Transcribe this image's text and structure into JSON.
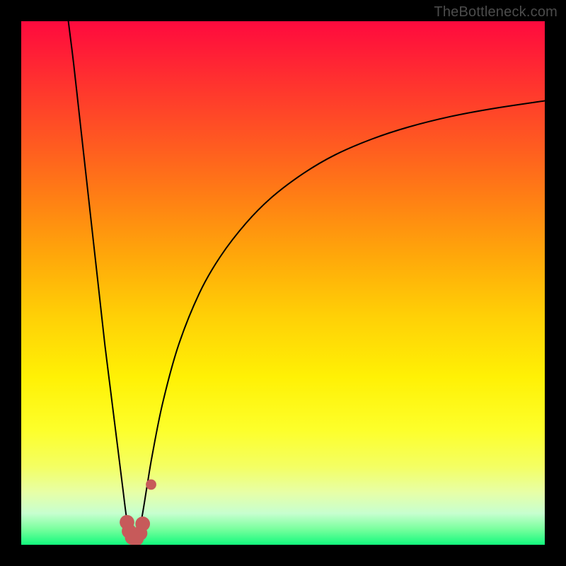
{
  "watermark": "TheBottleneck.com",
  "chart_data": {
    "type": "line",
    "title": "",
    "xlabel": "",
    "ylabel": "",
    "xlim": [
      0,
      100
    ],
    "ylim": [
      0,
      100
    ],
    "grid": false,
    "legend": false,
    "optimal_x": 21.5,
    "series": [
      {
        "name": "left-curve",
        "stroke": "#000000",
        "values": [
          {
            "x": 9.0,
            "y": 100.0
          },
          {
            "x": 10.0,
            "y": 92.0
          },
          {
            "x": 11.0,
            "y": 83.0
          },
          {
            "x": 12.0,
            "y": 74.0
          },
          {
            "x": 13.0,
            "y": 65.0
          },
          {
            "x": 14.0,
            "y": 56.0
          },
          {
            "x": 15.0,
            "y": 47.0
          },
          {
            "x": 16.0,
            "y": 38.0
          },
          {
            "x": 17.0,
            "y": 30.0
          },
          {
            "x": 18.0,
            "y": 22.0
          },
          {
            "x": 19.0,
            "y": 14.0
          },
          {
            "x": 19.5,
            "y": 10.0
          },
          {
            "x": 20.0,
            "y": 6.0
          },
          {
            "x": 20.5,
            "y": 3.0
          },
          {
            "x": 21.0,
            "y": 1.0
          },
          {
            "x": 21.5,
            "y": 0.2
          }
        ]
      },
      {
        "name": "right-curve",
        "stroke": "#000000",
        "values": [
          {
            "x": 21.5,
            "y": 0.2
          },
          {
            "x": 22.0,
            "y": 1.0
          },
          {
            "x": 23.0,
            "y": 5.0
          },
          {
            "x": 24.0,
            "y": 11.0
          },
          {
            "x": 25.0,
            "y": 17.0
          },
          {
            "x": 27.0,
            "y": 27.0
          },
          {
            "x": 30.0,
            "y": 38.0
          },
          {
            "x": 34.0,
            "y": 48.0
          },
          {
            "x": 38.0,
            "y": 55.0
          },
          {
            "x": 43.0,
            "y": 61.5
          },
          {
            "x": 48.0,
            "y": 66.5
          },
          {
            "x": 54.0,
            "y": 71.0
          },
          {
            "x": 60.0,
            "y": 74.5
          },
          {
            "x": 67.0,
            "y": 77.5
          },
          {
            "x": 74.0,
            "y": 79.8
          },
          {
            "x": 82.0,
            "y": 81.8
          },
          {
            "x": 90.0,
            "y": 83.3
          },
          {
            "x": 100.0,
            "y": 84.8
          }
        ]
      }
    ],
    "markers": [
      {
        "name": "marker-left-1",
        "x": 20.2,
        "y": 4.3,
        "r": 1.4,
        "fill": "#c75a5a"
      },
      {
        "name": "marker-left-2",
        "x": 20.6,
        "y": 2.6,
        "r": 1.4,
        "fill": "#c75a5a"
      },
      {
        "name": "marker-left-3",
        "x": 21.2,
        "y": 1.4,
        "r": 1.4,
        "fill": "#c75a5a"
      },
      {
        "name": "marker-bottom-1",
        "x": 22.0,
        "y": 1.2,
        "r": 1.4,
        "fill": "#c75a5a"
      },
      {
        "name": "marker-right-1",
        "x": 22.7,
        "y": 2.2,
        "r": 1.4,
        "fill": "#c75a5a"
      },
      {
        "name": "marker-right-2",
        "x": 23.2,
        "y": 4.0,
        "r": 1.4,
        "fill": "#c75a5a"
      },
      {
        "name": "marker-gap",
        "x": 24.8,
        "y": 11.5,
        "r": 1.0,
        "fill": "#c75a5a"
      }
    ],
    "gradient_stops": [
      {
        "pct": 0,
        "color": "#ff0a3e"
      },
      {
        "pct": 6,
        "color": "#ff1e36"
      },
      {
        "pct": 14,
        "color": "#ff3a2c"
      },
      {
        "pct": 24,
        "color": "#ff5c20"
      },
      {
        "pct": 34,
        "color": "#ff8014"
      },
      {
        "pct": 45,
        "color": "#ffa80a"
      },
      {
        "pct": 56,
        "color": "#ffcf06"
      },
      {
        "pct": 68,
        "color": "#fff105"
      },
      {
        "pct": 78,
        "color": "#fdff2a"
      },
      {
        "pct": 85,
        "color": "#f4ff62"
      },
      {
        "pct": 90,
        "color": "#e7ffa7"
      },
      {
        "pct": 94,
        "color": "#c7ffcf"
      },
      {
        "pct": 97,
        "color": "#79ff9e"
      },
      {
        "pct": 100,
        "color": "#13f97d"
      }
    ]
  }
}
